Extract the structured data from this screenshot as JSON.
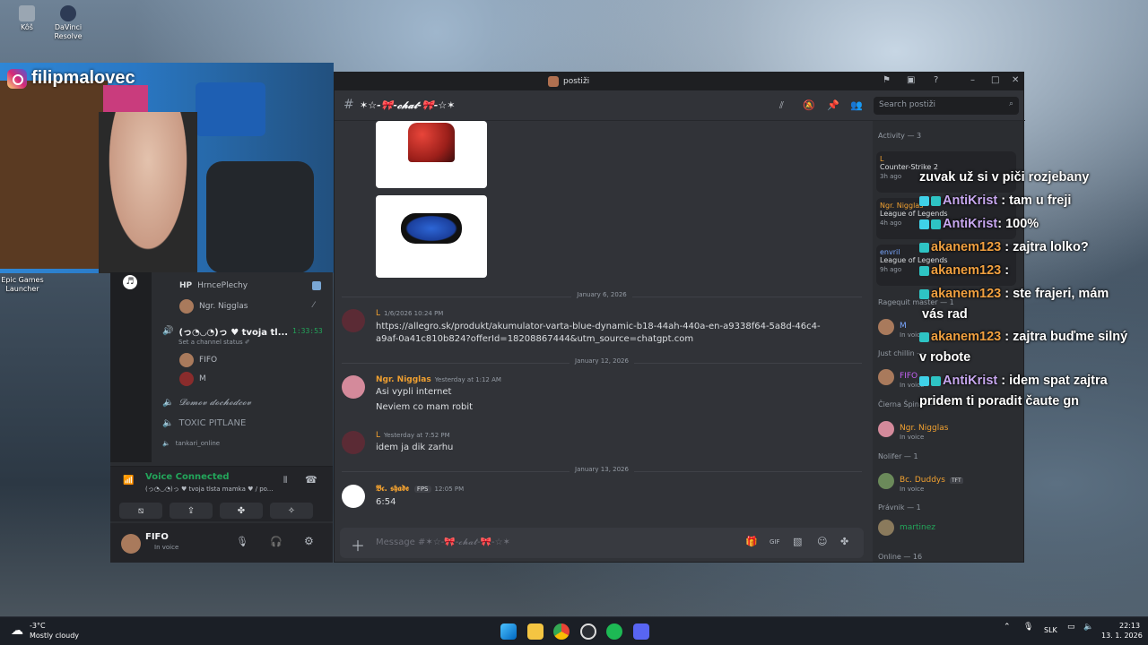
{
  "desktop": {
    "icons": [
      {
        "label": "Kôš",
        "icon": "recycle-bin-icon"
      },
      {
        "label": "DaVinci Resolve",
        "icon": "davinci-icon"
      },
      {
        "label": "Epic Games Launcher",
        "icon": "epic-icon"
      }
    ]
  },
  "webcam": {
    "instagram": "filipmalovec"
  },
  "left_panel": {
    "voice_users": [
      {
        "prefix": "HP",
        "name": "HrncePlechy"
      },
      {
        "name": "Ngr. Nigglas"
      }
    ],
    "active_channel": {
      "name": "(っ◔◡◔)っ ♥ tvoja tl...",
      "timer": "1:33:53",
      "status": "Set a channel status ✐"
    },
    "channel_users": [
      "FIFO",
      "M"
    ],
    "channels": [
      "𝓓𝓸𝓶𝓸𝓿 𝓭𝓸𝓬𝓱𝓸𝓭𝓬𝓸𝓿",
      "TOXIC PITLANE",
      "tankari_online"
    ],
    "voice_connected": {
      "title": "Voice Connected",
      "sub": "(っ◔◡◔)っ ♥ tvoja tlsta mamka ♥ / po..."
    },
    "user": {
      "name": "FIFO",
      "status": "In voice"
    }
  },
  "window": {
    "title": "postiži",
    "channel": "✶☆-🎀-𝓬𝓱𝓪𝓽-🎀-☆✶",
    "search_placeholder": "Search postiži",
    "composer_placeholder": "Message #✶☆-🎀-𝓬𝓱𝓪𝓽-🎀-☆✶"
  },
  "messages": {
    "sep1": "January 6, 2026",
    "m1": {
      "author": "L",
      "time": "1/6/2026 10:24 PM",
      "link": "https://allegro.sk/produkt/akumulator-varta-blue-dynamic-b18-44ah-440a-en-a9338f64-5a8d-46c4-a9af-0a41c810b824?offerId=18208867444&utm_source=chatgpt.com"
    },
    "sep2": "January 12, 2026",
    "m2": {
      "author": "Ngr. Nigglas",
      "time": "Yesterday at 1:12 AM",
      "lines": [
        "Asi vypli internet",
        "Neviem co mam robit"
      ]
    },
    "m3": {
      "author": "L",
      "time": "Yesterday at 7:52 PM",
      "text": "idem ja dik zarhu"
    },
    "sep3": "January 13, 2026",
    "m4": {
      "author": "𝕭𝖈. 𝖘𝖍𝖆𝖉𝖊",
      "tag": "FPS",
      "time": "12:05 PM",
      "text": "6:54"
    }
  },
  "members": {
    "activity_header": "Activity — 3",
    "activities": [
      {
        "name": "L",
        "game": "Counter-Strike 2",
        "time": "3h ago"
      },
      {
        "name": "Ngr. Nigglas",
        "game": "League of Legends",
        "time": "4h ago"
      },
      {
        "name": "envril",
        "game": "League of Legends",
        "time": "9h ago"
      }
    ],
    "groups": [
      {
        "cat": "Ragequit master — 1",
        "name": "M",
        "status": "In voice"
      },
      {
        "cat": "Just chillin —",
        "name": "FIFO",
        "status": "In voice"
      },
      {
        "cat": "Čierna Špina —",
        "name": "Ngr. Nigglas",
        "status": "In voice"
      },
      {
        "cat": "Nolifer — 1",
        "name": "Bc. Duddys",
        "tag": "TFT",
        "status": "In voice"
      },
      {
        "cat": "Právnik — 1",
        "name": "martinez"
      },
      {
        "cat": "Online — 16"
      }
    ]
  },
  "overlay_chat": [
    {
      "text": "zuvak už si v piči rozjebany"
    },
    {
      "name": "AntiKrist",
      "text": ": tam u freji",
      "color": "n1"
    },
    {
      "name": "AntiKrist",
      "text": ": 100%",
      "color": "n1"
    },
    {
      "name": "akanem123",
      "text": ": zajtra lolko?",
      "color": "n2"
    },
    {
      "name": "akanem123",
      "text": ":",
      "color": "n2"
    },
    {
      "name": "akanem123",
      "text": ": ste frajeri, mám",
      "color": "n2"
    },
    {
      "text": "vás rad"
    },
    {
      "name": "akanem123",
      "text": ": zajtra buďme silný",
      "color": "n2"
    },
    {
      "text": "v robote"
    },
    {
      "name": "AntiKrist",
      "text": ": idem spat zajtra",
      "color": "n1"
    },
    {
      "text": "pridem ti poradit čaute gn"
    }
  ],
  "taskbar": {
    "weather_temp": "-3°C",
    "weather_desc": "Mostly cloudy",
    "lang": "SLK",
    "time": "22:13",
    "date": "13. 1. 2026"
  }
}
